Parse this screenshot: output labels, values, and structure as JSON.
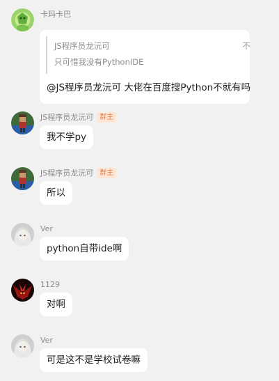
{
  "messages": [
    {
      "sender": "卡玛卡巴",
      "avatar_icon": "green-character-avatar-icon",
      "quote": {
        "author": "JS程序员龙沅可",
        "text": "只可惜我没有PythonIDE",
        "close_label": "不"
      },
      "text": "@JS程序员龙沅可 大佬在百度搜Python不就有吗"
    },
    {
      "sender": "JS程序员龙沅可",
      "badge": "群主",
      "avatar_icon": "pixel-character-avatar-icon",
      "text": "我不学py"
    },
    {
      "sender": "JS程序员龙沅可",
      "badge": "群主",
      "avatar_icon": "pixel-character-avatar-icon",
      "text": "所以"
    },
    {
      "sender": "Ver",
      "avatar_icon": "gray-anime-girl-avatar-icon",
      "text": "python自带ide啊"
    },
    {
      "sender": "1129",
      "avatar_icon": "red-dragon-avatar-icon",
      "text": "对啊"
    },
    {
      "sender": "Ver",
      "avatar_icon": "gray-anime-girl-avatar-icon",
      "text": "可是这不是学校试卷嘛"
    }
  ]
}
